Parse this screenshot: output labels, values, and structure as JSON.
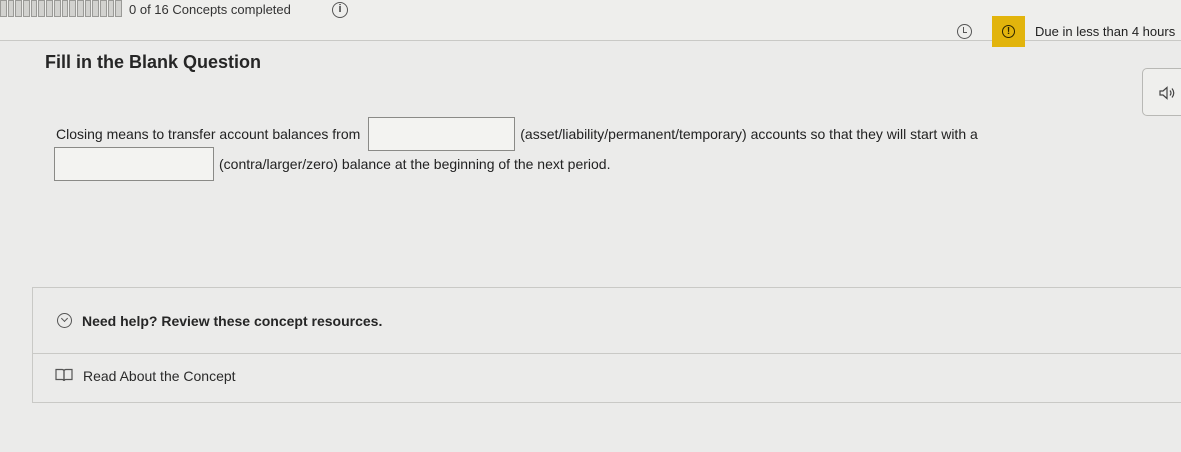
{
  "header": {
    "concepts_completed": "0 of 16 Concepts completed",
    "progress_segments": 16,
    "completed_segments": 0,
    "due_text": "Due in less than 4 hours",
    "info_icon": "info-icon",
    "clock_icon": "clock-icon",
    "alert_icon": "alert-icon",
    "badge_color": "#e2b40c"
  },
  "question": {
    "title": "Fill in the Blank Question",
    "audio_icon": "speaker-icon",
    "text_before_blank1": "Closing means to transfer account balances from",
    "blank1_value": "",
    "text_after_blank1": "(asset/liability/permanent/temporary) accounts so that they will start with a",
    "blank2_value": "",
    "text_after_blank2": "(contra/larger/zero) balance at the beginning of the next period."
  },
  "help": {
    "title": "Need help? Review these concept resources.",
    "chevron_icon": "chevron-down-icon",
    "resources": [
      {
        "label": "Read About the Concept",
        "icon": "book-icon"
      }
    ]
  }
}
